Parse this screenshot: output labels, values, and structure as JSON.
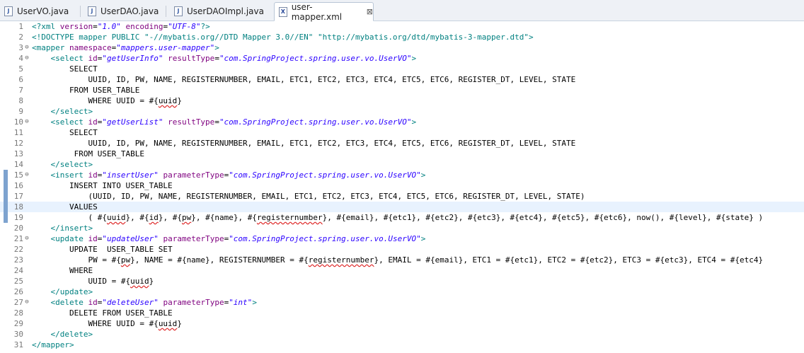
{
  "tabs": [
    {
      "label": "UserVO.java",
      "icon": "java-file-icon"
    },
    {
      "label": "UserDAO.java",
      "icon": "java-file-icon"
    },
    {
      "label": "UserDAOImpl.java",
      "icon": "java-file-icon"
    },
    {
      "label": "user-mapper.xml",
      "icon": "xml-file-icon",
      "active": true,
      "close": "⊠"
    }
  ],
  "editor": {
    "lines": [
      {
        "n": "1",
        "s": [
          [
            "p",
            "<?"
          ],
          [
            "t",
            "xml"
          ],
          [
            "tx",
            " "
          ],
          [
            "a",
            "version"
          ],
          [
            "tx",
            "="
          ],
          [
            "v",
            "\"1.0\""
          ],
          [
            "tx",
            " "
          ],
          [
            "a",
            "encoding"
          ],
          [
            "tx",
            "="
          ],
          [
            "v",
            "\"UTF-8\""
          ],
          [
            "p",
            "?>"
          ]
        ]
      },
      {
        "n": "2",
        "s": [
          [
            "dt",
            "<!DOCTYPE mapper PUBLIC \"-//mybatis.org//DTD Mapper 3.0//EN\" \"http://mybatis.org/dtd/mybatis-3-mapper.dtd\">"
          ]
        ]
      },
      {
        "n": "3",
        "fold": "⊖",
        "s": [
          [
            "t",
            "<mapper"
          ],
          [
            "tx",
            " "
          ],
          [
            "a",
            "namespace"
          ],
          [
            "tx",
            "="
          ],
          [
            "v",
            "\"mappers.user-mapper\""
          ],
          [
            "t",
            ">"
          ]
        ]
      },
      {
        "n": "4",
        "fold": "⊖",
        "s": [
          [
            "tx",
            "    "
          ],
          [
            "t",
            "<select"
          ],
          [
            "tx",
            " "
          ],
          [
            "a",
            "id"
          ],
          [
            "tx",
            "="
          ],
          [
            "v",
            "\"getUserInfo\""
          ],
          [
            "tx",
            " "
          ],
          [
            "a",
            "resultType"
          ],
          [
            "tx",
            "="
          ],
          [
            "v",
            "\"com.SpringProject.spring.user.vo.UserVO\""
          ],
          [
            "t",
            ">"
          ]
        ]
      },
      {
        "n": "5",
        "s": [
          [
            "tx",
            "        SELECT"
          ]
        ]
      },
      {
        "n": "6",
        "s": [
          [
            "tx",
            "            UUID, ID, PW, NAME, REGISTERNUMBER, EMAIL, ETC1, ETC2, ETC3, ETC4, ETC5, ETC6, REGISTER_DT, LEVEL, STATE"
          ]
        ]
      },
      {
        "n": "7",
        "s": [
          [
            "tx",
            "        FROM USER_TABLE"
          ]
        ]
      },
      {
        "n": "8",
        "s": [
          [
            "tx",
            "            WHERE UUID = #{"
          ],
          [
            "err",
            "uuid"
          ],
          [
            "tx",
            "}"
          ]
        ]
      },
      {
        "n": "9",
        "s": [
          [
            "tx",
            "    "
          ],
          [
            "t",
            "</select>"
          ]
        ]
      },
      {
        "n": "10",
        "fold": "⊖",
        "s": [
          [
            "tx",
            "    "
          ],
          [
            "t",
            "<select"
          ],
          [
            "tx",
            " "
          ],
          [
            "a",
            "id"
          ],
          [
            "tx",
            "="
          ],
          [
            "v",
            "\"getUserList\""
          ],
          [
            "tx",
            " "
          ],
          [
            "a",
            "resultType"
          ],
          [
            "tx",
            "="
          ],
          [
            "v",
            "\"com.SpringProject.spring.user.vo.UserVO\""
          ],
          [
            "t",
            ">"
          ]
        ]
      },
      {
        "n": "11",
        "s": [
          [
            "tx",
            "        SELECT"
          ]
        ]
      },
      {
        "n": "12",
        "s": [
          [
            "tx",
            "            UUID, ID, PW, NAME, REGISTERNUMBER, EMAIL, ETC1, ETC2, ETC3, ETC4, ETC5, ETC6, REGISTER_DT, LEVEL, STATE"
          ]
        ]
      },
      {
        "n": "13",
        "s": [
          [
            "tx",
            "         FROM USER_TABLE"
          ]
        ]
      },
      {
        "n": "14",
        "s": [
          [
            "tx",
            "    "
          ],
          [
            "t",
            "</select>"
          ]
        ]
      },
      {
        "n": "15",
        "fold": "⊖",
        "chg": true,
        "s": [
          [
            "tx",
            "    "
          ],
          [
            "t",
            "<insert"
          ],
          [
            "tx",
            " "
          ],
          [
            "a",
            "id"
          ],
          [
            "tx",
            "="
          ],
          [
            "v",
            "\"insertUser\""
          ],
          [
            "tx",
            " "
          ],
          [
            "a",
            "parameterType"
          ],
          [
            "tx",
            "="
          ],
          [
            "v",
            "\"com.SpringProject.spring.user.vo.UserVO\""
          ],
          [
            "t",
            ">"
          ]
        ]
      },
      {
        "n": "16",
        "chg": true,
        "s": [
          [
            "tx",
            "        INSERT INTO USER_TABLE"
          ]
        ]
      },
      {
        "n": "17",
        "chg": true,
        "s": [
          [
            "tx",
            "            (UUID, ID, PW, NAME, REGISTERNUMBER, EMAIL, ETC1, ETC2, ETC3, ETC4, ETC5, ETC6, REGISTER_DT, LEVEL, STATE)"
          ]
        ]
      },
      {
        "n": "18",
        "chg": true,
        "hl": true,
        "s": [
          [
            "tx",
            "        VALUES"
          ]
        ]
      },
      {
        "n": "19",
        "chg": true,
        "s": [
          [
            "tx",
            "            ( #{"
          ],
          [
            "err",
            "uuid"
          ],
          [
            "tx",
            "}, #{"
          ],
          [
            "err",
            "id"
          ],
          [
            "tx",
            "}, #{"
          ],
          [
            "err",
            "pw"
          ],
          [
            "tx",
            "}, #{name}, #{"
          ],
          [
            "err",
            "registernumber"
          ],
          [
            "tx",
            "}, #{email}, #{etc1}, #{etc2}, #{etc3}, #{etc4}, #{etc5}, #{etc6}, now(), #{level}, #{state} )"
          ]
        ]
      },
      {
        "n": "20",
        "s": [
          [
            "tx",
            "    "
          ],
          [
            "t",
            "</insert>"
          ]
        ]
      },
      {
        "n": "21",
        "fold": "⊖",
        "s": [
          [
            "tx",
            "    "
          ],
          [
            "t",
            "<update"
          ],
          [
            "tx",
            " "
          ],
          [
            "a",
            "id"
          ],
          [
            "tx",
            "="
          ],
          [
            "v",
            "\"updateUser\""
          ],
          [
            "tx",
            " "
          ],
          [
            "a",
            "parameterType"
          ],
          [
            "tx",
            "="
          ],
          [
            "v",
            "\"com.SpringProject.spring.user.vo.UserVO\""
          ],
          [
            "t",
            ">"
          ]
        ]
      },
      {
        "n": "22",
        "s": [
          [
            "tx",
            "        UPDATE  USER_TABLE SET"
          ]
        ]
      },
      {
        "n": "23",
        "s": [
          [
            "tx",
            "            PW = #{"
          ],
          [
            "err",
            "pw"
          ],
          [
            "tx",
            "}, NAME = #{name}, REGISTERNUMBER = #{"
          ],
          [
            "err",
            "registernumber"
          ],
          [
            "tx",
            "}, EMAIL = #{email}, ETC1 = #{etc1}, ETC2 = #{etc2}, ETC3 = #{etc3}, ETC4 = #{etc4}"
          ]
        ]
      },
      {
        "n": "24",
        "s": [
          [
            "tx",
            "        WHERE"
          ]
        ]
      },
      {
        "n": "25",
        "s": [
          [
            "tx",
            "            UUID = #{"
          ],
          [
            "err",
            "uuid"
          ],
          [
            "tx",
            "}"
          ]
        ]
      },
      {
        "n": "26",
        "s": [
          [
            "tx",
            "    "
          ],
          [
            "t",
            "</update>"
          ]
        ]
      },
      {
        "n": "27",
        "fold": "⊖",
        "s": [
          [
            "tx",
            "    "
          ],
          [
            "t",
            "<delete"
          ],
          [
            "tx",
            " "
          ],
          [
            "a",
            "id"
          ],
          [
            "tx",
            "="
          ],
          [
            "v",
            "\"deleteUser\""
          ],
          [
            "tx",
            " "
          ],
          [
            "a",
            "parameterType"
          ],
          [
            "tx",
            "="
          ],
          [
            "v",
            "\"int\""
          ],
          [
            "t",
            ">"
          ]
        ]
      },
      {
        "n": "28",
        "s": [
          [
            "tx",
            "        DELETE FROM USER_TABLE"
          ]
        ]
      },
      {
        "n": "29",
        "s": [
          [
            "tx",
            "            WHERE UUID = #{"
          ],
          [
            "err",
            "uuid"
          ],
          [
            "tx",
            "}"
          ]
        ]
      },
      {
        "n": "30",
        "s": [
          [
            "tx",
            "    "
          ],
          [
            "t",
            "</delete>"
          ]
        ]
      },
      {
        "n": "31",
        "s": [
          [
            "t",
            "</mapper>"
          ]
        ]
      }
    ]
  }
}
